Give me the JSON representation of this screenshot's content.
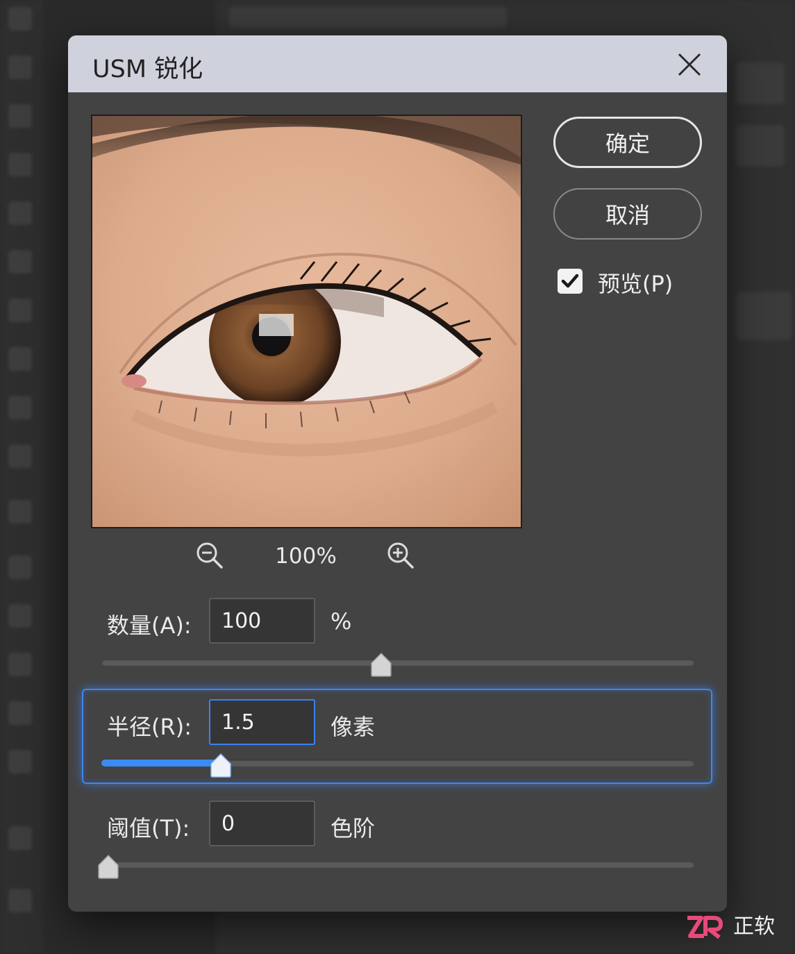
{
  "dialog": {
    "title": "USM 锐化",
    "ok_label": "确定",
    "cancel_label": "取消",
    "preview_label": "预览(P)",
    "preview_checked": true
  },
  "preview": {
    "zoom_level": "100%"
  },
  "fields": {
    "amount": {
      "label": "数量(A):",
      "value": "100",
      "unit": "%",
      "slider_fraction": 0.46
    },
    "radius": {
      "label": "半径(R):",
      "value": "1.5",
      "unit": "像素",
      "slider_fraction": 0.19
    },
    "threshold": {
      "label": "阈值(T):",
      "value": "0",
      "unit": "色阶",
      "slider_fraction": 0.0
    }
  },
  "colors": {
    "accent": "#3a8bf2",
    "dialog_bg": "#434343",
    "titlebar_bg": "#cfd2dc"
  },
  "watermark": {
    "brand": "正软"
  }
}
